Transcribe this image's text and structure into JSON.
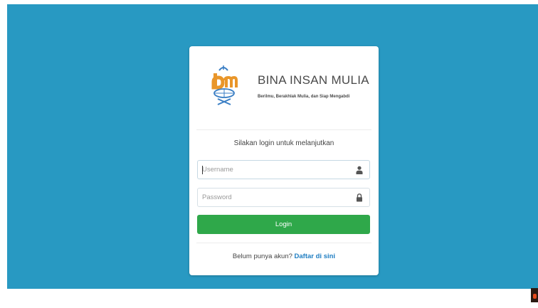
{
  "brand": {
    "name": "BINA INSAN MULIA",
    "tagline": "Berilmu, Berakhlak Mulia, dan Siap Mengabdi",
    "colors": {
      "logo_orange": "#e9962a",
      "logo_blue": "#3a7ec4"
    }
  },
  "login": {
    "prompt": "Silakan login untuk melanjutkan",
    "username": {
      "value": "",
      "placeholder": "Username",
      "icon": "user-icon"
    },
    "password": {
      "value": "",
      "placeholder": "Password",
      "icon": "lock-icon"
    },
    "submit_label": "Login",
    "register_text": "Belum punya akun?",
    "register_link": "Daftar di sini"
  },
  "colors": {
    "background": "#2899c2",
    "card": "#ffffff",
    "button": "#2fa84a",
    "link": "#1f7ec2"
  }
}
